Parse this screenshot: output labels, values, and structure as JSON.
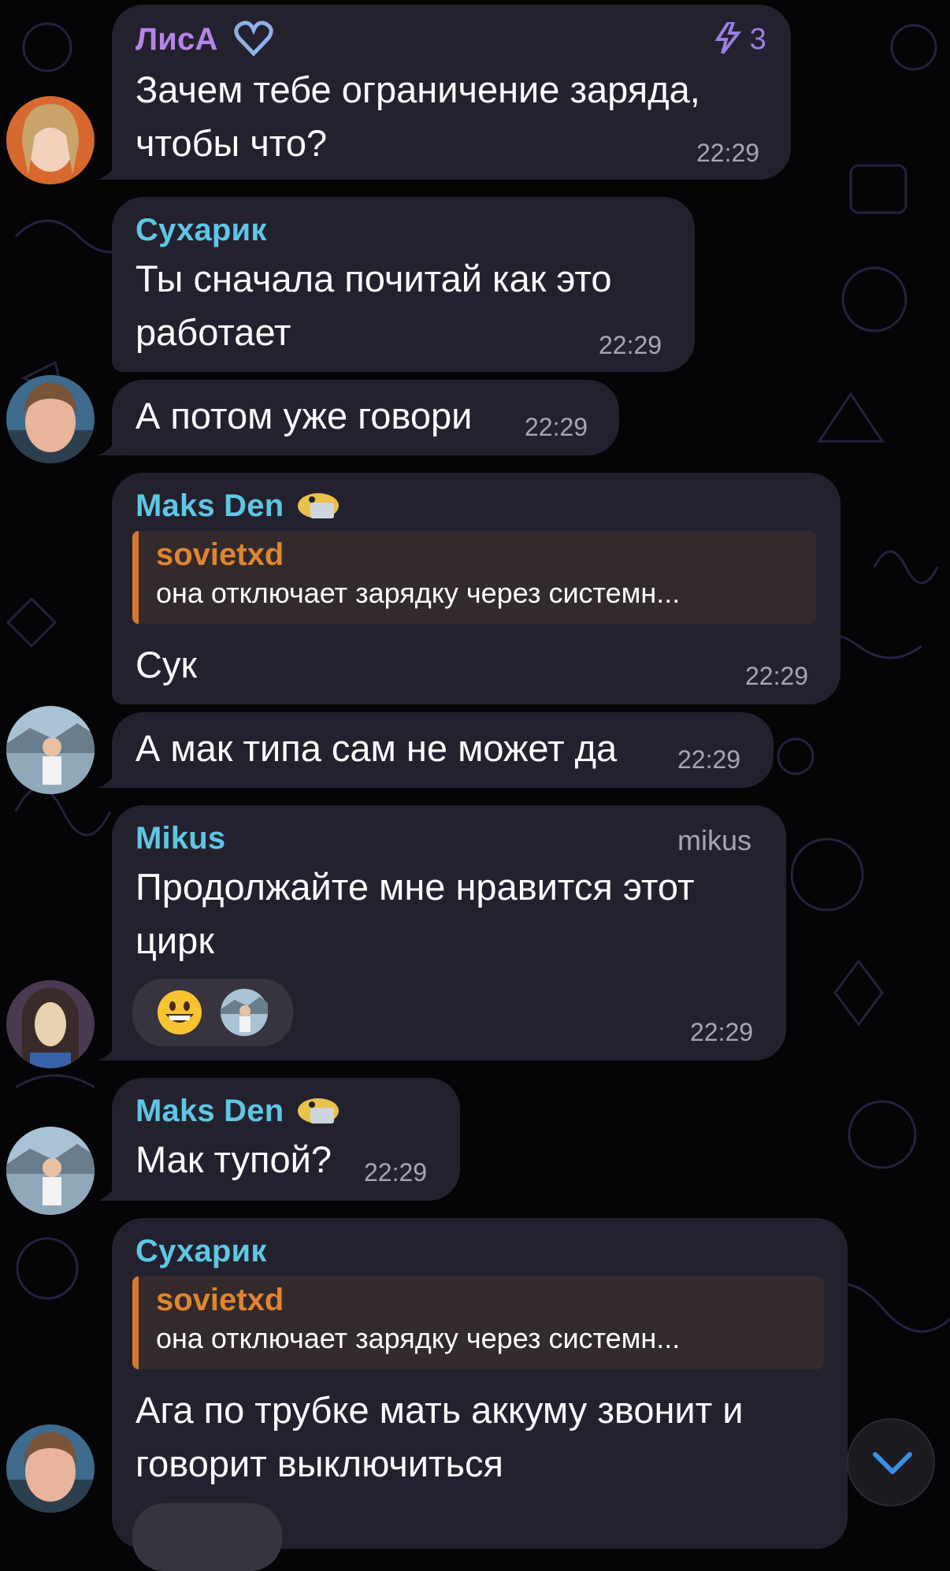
{
  "colors": {
    "background": "#050507",
    "bubble": "#24212f",
    "name_purple": "#b585e8",
    "name_cyan": "#5ec7e4",
    "reply_accent": "#d8772c",
    "time": "#a8a4b6",
    "scroll_arrow": "#3a8fe8"
  },
  "messages": [
    {
      "sender": "ЛисА",
      "sender_badge": "heart-outline-icon",
      "boost_icon": "boost-lightning-icon",
      "boost_count": "3",
      "lines": [
        "Зачем тебе ограничение заряда,",
        "чтобы что?"
      ],
      "time": "22:29"
    },
    {
      "sender": "Сухарик",
      "lines": [
        "Ты сначала почитай как это",
        "работает"
      ],
      "time": "22:29"
    },
    {
      "lines": [
        "А потом уже говори"
      ],
      "time": "22:29"
    },
    {
      "sender": "Maks Den",
      "sender_badge": "animated-sticker-icon",
      "reply": {
        "name": "sovietxd",
        "text": "она отключает зарядку через системн..."
      },
      "lines": [
        "Сук"
      ],
      "time": "22:29"
    },
    {
      "lines": [
        "А мак типа сам не может да"
      ],
      "time": "22:29"
    },
    {
      "sender": "Mikus",
      "right_label": "mikus",
      "lines": [
        "Продолжайте мне нравится этот",
        "цирк"
      ],
      "reactions": [
        "grinning-face-emoji",
        "reactor-avatar"
      ],
      "time": "22:29"
    },
    {
      "sender": "Maks Den",
      "sender_badge": "animated-sticker-icon",
      "lines": [
        "Мак тупой?"
      ],
      "time": "22:29"
    },
    {
      "sender": "Сухарик",
      "reply": {
        "name": "sovietxd",
        "text": "она отключает зарядку через системн..."
      },
      "lines": [
        "Ага по трубке мать аккуму звонит и",
        "говорит выключиться"
      ]
    }
  ],
  "scroll_button": {
    "icon": "chevron-down-icon"
  }
}
